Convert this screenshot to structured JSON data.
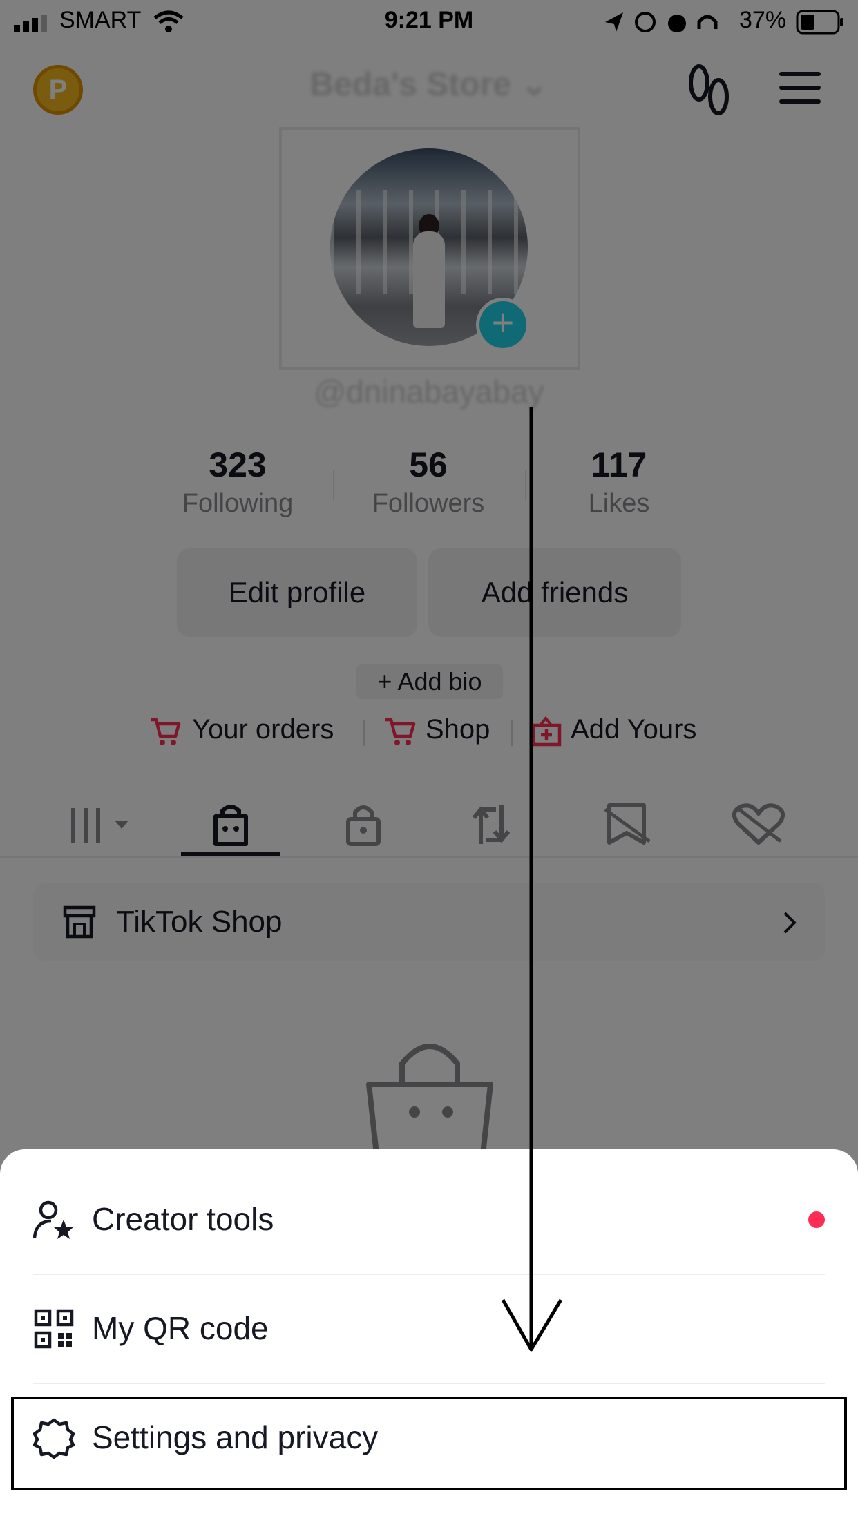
{
  "status_bar": {
    "carrier": "SMART",
    "time": "9:21 PM",
    "battery_percent": "37%"
  },
  "header": {
    "coin_letter": "P",
    "store_name": "Beda's Store",
    "footprints_icon": "footprints-icon",
    "menu_icon": "hamburger-menu-icon"
  },
  "profile": {
    "handle": "@dninabayabay",
    "stats": [
      {
        "value": "323",
        "label": "Following"
      },
      {
        "value": "56",
        "label": "Followers"
      },
      {
        "value": "117",
        "label": "Likes"
      }
    ],
    "edit_profile": "Edit profile",
    "add_friends": "Add friends",
    "add_bio": "+ Add bio",
    "links": {
      "orders": "Your orders",
      "shop": "Shop",
      "add_yours": "Add Yours"
    }
  },
  "tabs": [
    "videos-grid-icon",
    "shopping-bag-icon",
    "lock-icon",
    "repost-icon",
    "bookmark-hidden-icon",
    "liked-hidden-icon"
  ],
  "shop_row": {
    "label": "TikTok Shop"
  },
  "sheet": {
    "items": [
      {
        "label": "Creator tools",
        "icon": "creator-tools-icon",
        "has_dot": true
      },
      {
        "label": "My QR code",
        "icon": "qr-code-icon"
      },
      {
        "label": "Settings and privacy",
        "icon": "settings-gear-icon"
      }
    ]
  },
  "colors": {
    "accent_red": "#fe2c55",
    "badge_cyan": "#20d5ec"
  }
}
